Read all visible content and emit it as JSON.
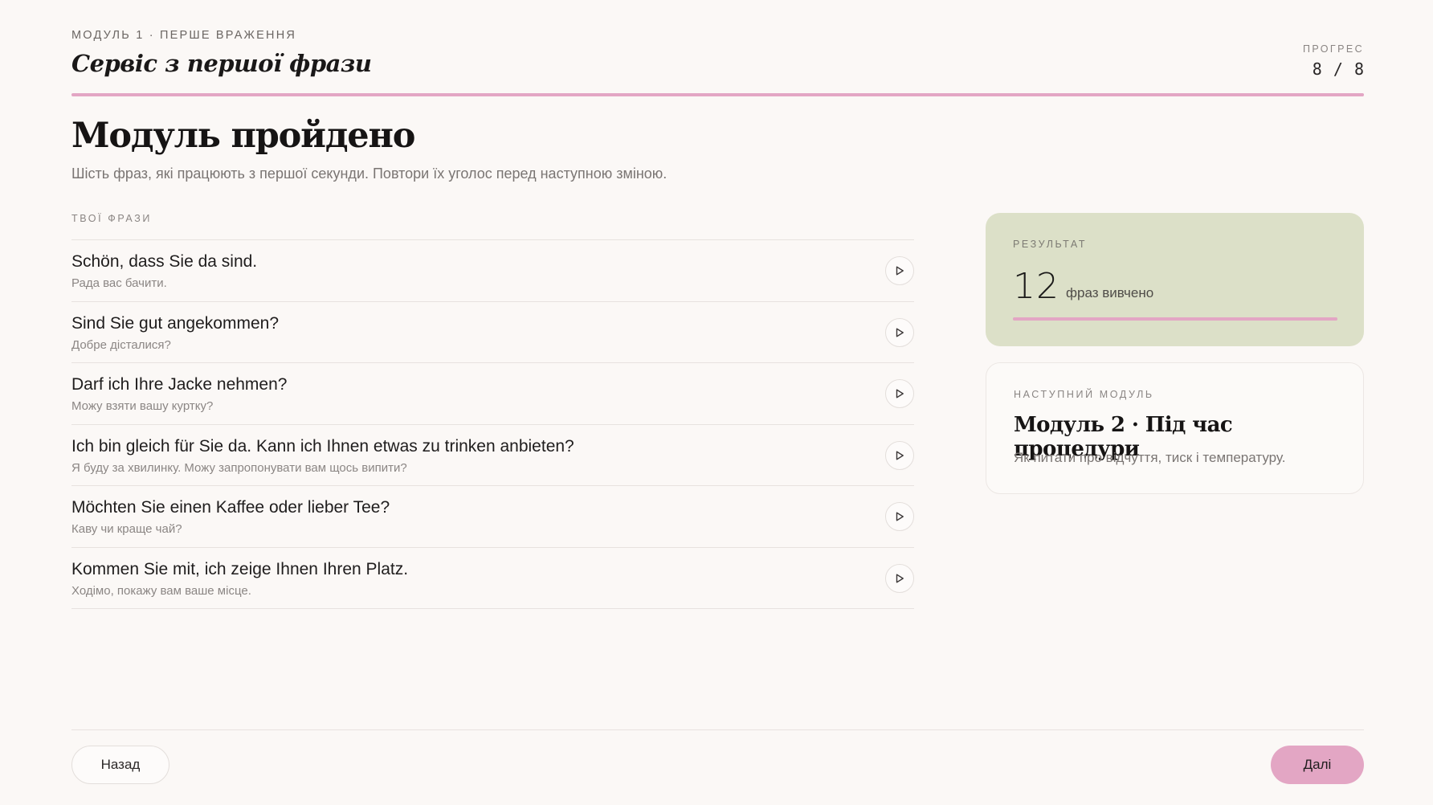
{
  "header": {
    "eyebrow": "МОДУЛЬ 1 · ПЕРШЕ ВРАЖЕННЯ",
    "module_title": "Сервіс з першої фрази",
    "progress_label": "ПРОГРЕС",
    "progress_value": "8 / 8",
    "progress_fraction": 1.0
  },
  "main": {
    "headline": "Модуль пройдено",
    "lead": "Шість фраз, які працюють з першої секунди. Повтори їх уголос перед наступною зміною."
  },
  "phrases": {
    "label": "ТВОЇ ФРАЗИ",
    "items": [
      {
        "de": "Schön, dass Sie da sind.",
        "uk": "Рада вас бачити."
      },
      {
        "de": "Sind Sie gut angekommen?",
        "uk": "Добре дісталися?"
      },
      {
        "de": "Darf ich Ihre Jacke nehmen?",
        "uk": "Можу взяти вашу куртку?"
      },
      {
        "de": "Ich bin gleich für Sie da. Kann ich Ihnen etwas zu trinken anbieten?",
        "uk": "Я буду за хвилинку. Можу запропонувати вам щось випити?"
      },
      {
        "de": "Möchten Sie einen Kaffee oder lieber Tee?",
        "uk": "Каву чи краще чай?"
      },
      {
        "de": "Kommen Sie mit, ich zeige Ihnen Ihren Platz.",
        "uk": "Ходімо, покажу вам ваше місце."
      }
    ],
    "play_icon": "play-icon"
  },
  "result": {
    "label": "РЕЗУЛЬТАТ",
    "count": "12",
    "unit": "фраз вивчено",
    "progress_fraction": 1.0
  },
  "next_module": {
    "label": "НАСТУПНИЙ МОДУЛЬ",
    "title": "Модуль 2 · Під час процедури",
    "description": "Як питати про відчуття, тиск і температуру."
  },
  "footer": {
    "back_label": "Назад",
    "next_label": "Далі"
  },
  "colors": {
    "accent": "#e3a6c4",
    "result_card": "#dce0c8",
    "background": "#fbf8f6"
  }
}
